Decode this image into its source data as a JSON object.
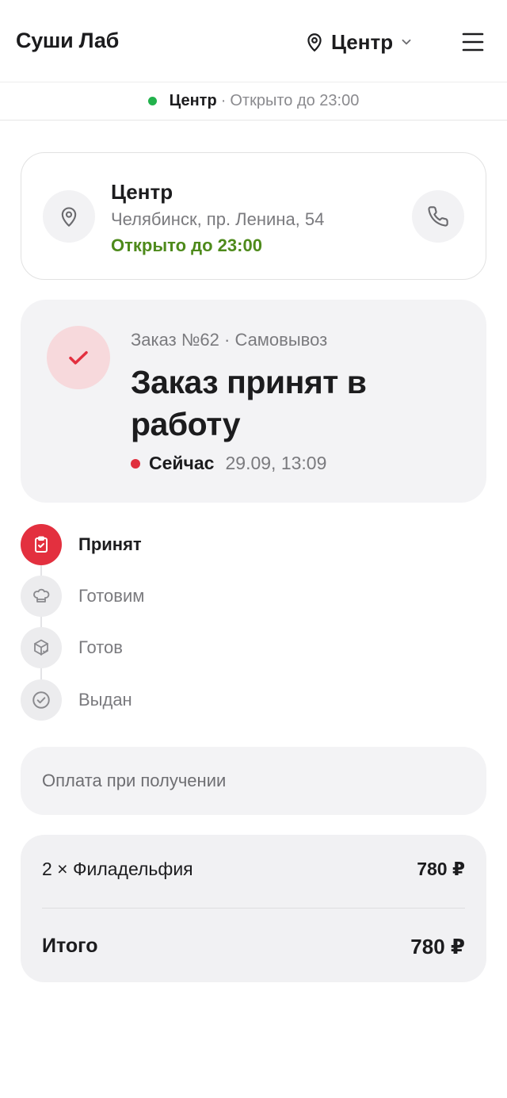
{
  "header": {
    "brand": "Суши Лаб",
    "branch": "Центр"
  },
  "status_bar": {
    "branch": "Центр",
    "separator": "·",
    "hours": "Открыто до 23:00",
    "status_color": "#22b24c"
  },
  "store": {
    "name": "Центр",
    "address": "Челябинск, пр. Ленина, 54",
    "open": "Открыто до 23:00"
  },
  "order": {
    "meta": "Заказ №62 · Самовывоз",
    "title": "Заказ принят в работу",
    "now": "Сейчас",
    "timestamp": "29.09, 13:09",
    "accent": "#e3303f"
  },
  "steps": [
    {
      "label": "Принят",
      "icon": "clipboard-check-icon",
      "active": true
    },
    {
      "label": "Готовим",
      "icon": "chef-hat-icon",
      "active": false
    },
    {
      "label": "Готов",
      "icon": "package-check-icon",
      "active": false
    },
    {
      "label": "Выдан",
      "icon": "circle-check-icon",
      "active": false
    }
  ],
  "payment": {
    "label": "Оплата при получении"
  },
  "summary": {
    "item_label": "2 × Филадельфия",
    "item_price": "780 ₽",
    "total_label": "Итого",
    "total_price": "780 ₽"
  }
}
